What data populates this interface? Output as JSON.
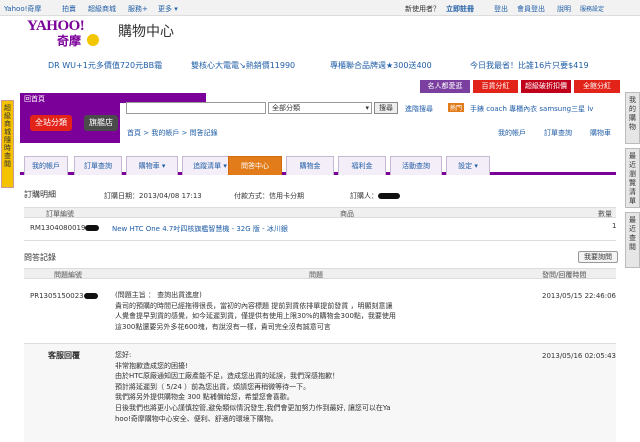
{
  "topbar": {
    "left": [
      "Yahoo!奇摩",
      "拍賣",
      "超級商城",
      "服務+",
      "更多 ▾"
    ],
    "greeting": "新使用者？",
    "greeting_link": "立即註冊",
    "right": [
      "登出",
      "會員登出",
      "說明",
      "服務設定",
      "企業服務網"
    ]
  },
  "logo": {
    "text": "YAHOO!",
    "sub": "奇摩"
  },
  "site_title": "購物中心",
  "promos": [
    "DR WU+1元多價值720元BB霜",
    "雙核心大電電↘熱銷價11990",
    "專櫃聯合品牌週★300送400",
    "今日我最省！比誰16片只要$419"
  ],
  "promo_buttons": [
    {
      "label": "名人都愛逛",
      "color": "#7b3fa0"
    },
    {
      "label": "百貨分紅",
      "color": "#e2231a"
    },
    {
      "label": "超級破折扣價",
      "color": "#c0001b"
    },
    {
      "label": "全館分紅",
      "color": "#e2231a"
    }
  ],
  "left_badge": "超級商城隨時查閱",
  "right_tabs": [
    "我的購物",
    "最近瀏覽清單",
    "最近查閱"
  ],
  "header": {
    "label": "回首頁",
    "cat_all": "全站分類",
    "cat_flag": "旗艦店",
    "search_select": "全部分類",
    "search_button": "搜尋",
    "advanced": "進階搜尋",
    "hot_label": "熱門",
    "hot_keywords": "手錶  coach 專櫃內衣  samsung三星  lv",
    "my_account": "我的帳戶",
    "order_query": "訂單查詢",
    "cart": "購物車"
  },
  "breadcrumb": "首頁 > 我的帳戶 > 問答記錄",
  "nav_tabs": [
    "我的帳戶",
    "訂單查詢",
    "購物車 ▾",
    "追蹤清單 ▾",
    "問答中心",
    "購物金",
    "福利金",
    "活動查詢",
    "設定 ▾"
  ],
  "order": {
    "section_title": "訂購明細",
    "date_label": "訂購日期：2013/04/08 17:13",
    "pay_label": "付款方式：信用卡分期",
    "buyer_label": "訂購人：",
    "col_order": "訂單編號",
    "col_item": "商品",
    "col_qty": "數量",
    "order_id": "RM1304080019",
    "item": "New HTC One 4.7吋四核旗艦智慧機 - 32G 版 - 冰川銀",
    "qty": "1"
  },
  "qa": {
    "section_title": "問答記錄",
    "ask_button": "我要詢問",
    "col_id": "問題編號",
    "col_q": "問題",
    "col_time": "發問/回覆時間",
    "q_id": "PR1305150023",
    "q_subject": "(問題主旨 ： 查詢出貨進度)",
    "q_lines": [
      "貴司的預購的時間已經拖得很長，當初的內容標題 提前到貨依排單提前發貨 ，明顯刻意讓",
      "人覺會提早到貨的感覺，如今延遲到貨，僅提供有使用上限30%的購物金300點，我要使用",
      "這300點還要另外多花600塊，有說沒有一樣，貴司完全沒有誠意可言"
    ],
    "q_time": "2013/05/15 22:46:06",
    "reply_label": "客服回覆",
    "r_lines": [
      "您好:",
      "非常抱歉造成您的困擾!",
      "由於HTC原廠通知因工廠產能不足，造成您出貨的延誤，我們深感抱歉！",
      "預計將延遲到（ 5/24 ）前為您出貨，煩請您再稍微等待一下。",
      "我們將另外提供購物金 300 點補償給您，希望您會喜歡。",
      "日後我們也將更小心謹慎控管,避免類似情況發生,我們會更加努力作到最好, 讓您可以在Ya",
      "hoo!奇摩購物中心安全、便利、舒適的環境下購物。"
    ],
    "r_time": "2013/05/16 02:05:43"
  }
}
